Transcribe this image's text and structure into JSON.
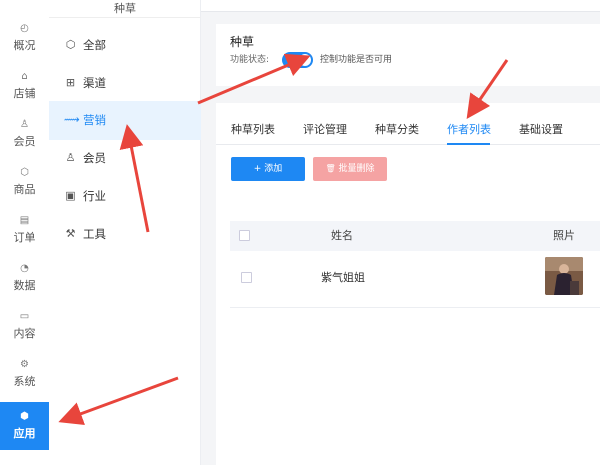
{
  "rail": {
    "items": [
      {
        "label": "概况",
        "icon": "dashboard-icon"
      },
      {
        "label": "店铺",
        "icon": "shop-icon"
      },
      {
        "label": "会员",
        "icon": "user-icon"
      },
      {
        "label": "商品",
        "icon": "box-icon"
      },
      {
        "label": "订单",
        "icon": "clipboard-icon"
      },
      {
        "label": "数据",
        "icon": "pie-chart-icon"
      },
      {
        "label": "内容",
        "icon": "folder-icon"
      },
      {
        "label": "系统",
        "icon": "gear-icon"
      },
      {
        "label": "应用",
        "icon": "cube-icon"
      }
    ],
    "active_index": 8
  },
  "subnav": {
    "title": "种草",
    "items": [
      {
        "label": "全部",
        "icon": "cube-icon"
      },
      {
        "label": "渠道",
        "icon": "channel-icon"
      },
      {
        "label": "营销",
        "icon": "trend-icon"
      },
      {
        "label": "会员",
        "icon": "user-icon"
      },
      {
        "label": "行业",
        "icon": "industry-icon"
      },
      {
        "label": "工具",
        "icon": "wrench-icon"
      }
    ],
    "active_index": 2
  },
  "feature": {
    "title": "种草",
    "status_label": "功能状态:",
    "toggle_on": true,
    "toggle_hint": "控制功能是否可用"
  },
  "tabs": {
    "items": [
      "种草列表",
      "评论管理",
      "种草分类",
      "作者列表",
      "基础设置"
    ],
    "active_index": 3
  },
  "actions": {
    "add_label": "+ 添加",
    "bulk_delete_label": "批量删除"
  },
  "table": {
    "columns": [
      "姓名",
      "照片"
    ],
    "rows": [
      {
        "name": "紫气姐姐",
        "photo": "author-photo"
      }
    ]
  },
  "colors": {
    "accent": "#1e88f3",
    "danger_light": "#f5a3a3",
    "arrow": "#e8453c"
  }
}
